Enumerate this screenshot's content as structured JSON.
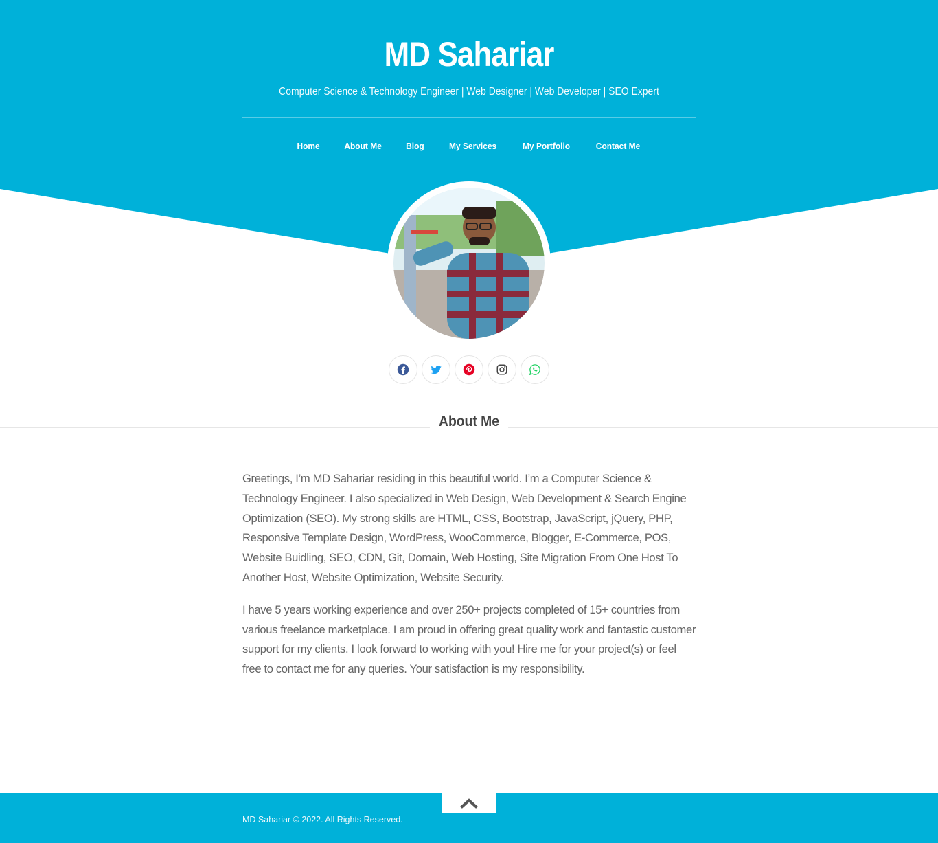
{
  "colors": {
    "brand": "#00b1d9",
    "text": "#666666",
    "heading": "#444444"
  },
  "header": {
    "title": "MD Sahariar",
    "tagline": "Computer Science & Technology Engineer | Web Designer | Web Developer | SEO Expert"
  },
  "nav": {
    "items": [
      {
        "label": "Home"
      },
      {
        "label": "About Me"
      },
      {
        "label": "Blog"
      },
      {
        "label": "My Services"
      },
      {
        "label": "My Portfolio"
      },
      {
        "label": "Contact Me"
      }
    ]
  },
  "profile": {
    "avatar_icon": "profile-photo"
  },
  "social": {
    "icons": [
      "facebook-icon",
      "twitter-icon",
      "pinterest-icon",
      "instagram-icon",
      "whatsapp-icon"
    ]
  },
  "about": {
    "heading": "About Me",
    "paragraphs": [
      "Greetings, I’m MD Sahariar residing in this beautiful world. I’m a Computer Science & Technology Engineer. I also specialized in Web Design, Web Development & Search Engine Optimization (SEO). My strong skills are HTML, CSS, Bootstrap, JavaScript, jQuery, PHP, Responsive Template Design, WordPress, WooCommerce, Blogger, E-Commerce, POS, Website Buidling, SEO, CDN, Git, Domain, Web Hosting, Site Migration From One Host To Another Host, Website Optimization, Website Security.",
      "I have 5 years working experience and over 250+ projects completed of 15+ countries from various freelance marketplace. I am proud in offering great quality work and fantastic customer support for my clients. I look forward to working with you! Hire me for your project(s) or feel free to contact me for any queries. Your satisfaction is my responsibility."
    ]
  },
  "footer": {
    "copyright": "MD Sahariar © 2022. All Rights Reserved.",
    "to_top_icon": "chevron-up-icon"
  }
}
